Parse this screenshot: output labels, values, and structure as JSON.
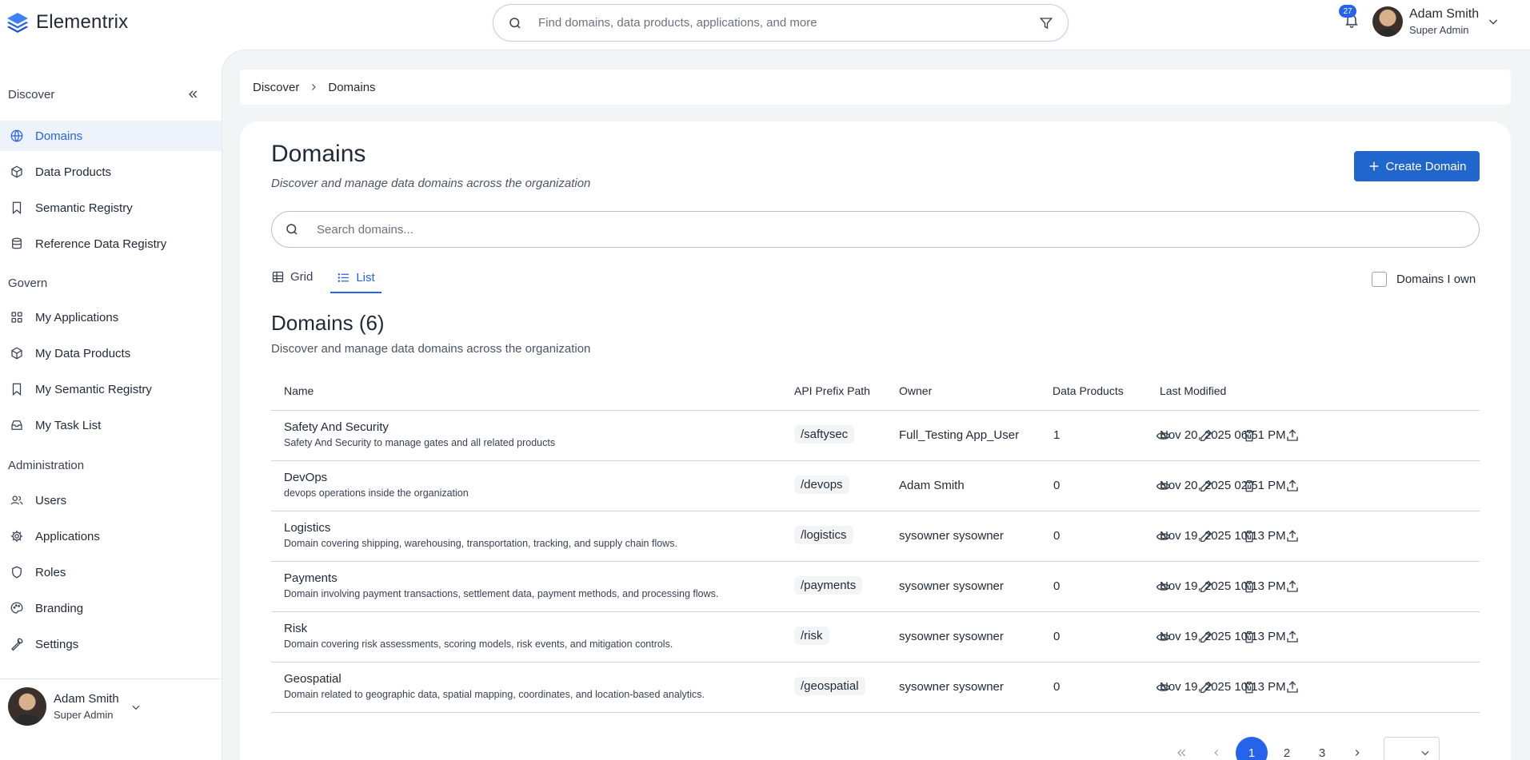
{
  "app": {
    "name": "Elementrix"
  },
  "global_search": {
    "placeholder": "Find domains, data products, applications, and more"
  },
  "notifications": {
    "count": "27"
  },
  "user": {
    "name": "Adam Smith",
    "role": "Super Admin"
  },
  "sidebar": {
    "discover_heading": "Discover",
    "discover_items": [
      {
        "label": "Domains",
        "icon": "globe-icon",
        "active": true
      },
      {
        "label": "Data Products",
        "icon": "cube-icon"
      },
      {
        "label": "Semantic Registry",
        "icon": "bookmark-icon"
      },
      {
        "label": "Reference Data Registry",
        "icon": "database-icon"
      }
    ],
    "govern_heading": "Govern",
    "govern_items": [
      {
        "label": "My Applications",
        "icon": "grid-icon"
      },
      {
        "label": "My Data Products",
        "icon": "cube-icon"
      },
      {
        "label": "My Semantic Registry",
        "icon": "bookmark-icon"
      },
      {
        "label": "My Task List",
        "icon": "inbox-icon"
      }
    ],
    "admin_heading": "Administration",
    "admin_items": [
      {
        "label": "Users",
        "icon": "users-icon"
      },
      {
        "label": "Applications",
        "icon": "gear-icon"
      },
      {
        "label": "Roles",
        "icon": "shield-icon"
      },
      {
        "label": "Branding",
        "icon": "palette-icon"
      },
      {
        "label": "Settings",
        "icon": "wrench-icon"
      }
    ]
  },
  "breadcrumb": [
    "Discover",
    "Domains"
  ],
  "page": {
    "title": "Domains",
    "subtitle": "Discover and manage data domains across the organization",
    "create_button": "Create Domain",
    "search_placeholder": "Search domains...",
    "view_grid": "Grid",
    "view_list": "List",
    "active_view": "List",
    "own_filter_label": "Domains I own",
    "list_title": "Domains (6)",
    "list_subtitle": "Discover and manage data domains across the organization"
  },
  "table": {
    "columns": [
      "Name",
      "API Prefix Path",
      "Owner",
      "Data Products",
      "Last Modified"
    ],
    "rows": [
      {
        "name": "Safety And Security",
        "description": "Safety And Security to manage gates and all related products",
        "prefix": "/saftysec",
        "owner": "Full_Testing App_User",
        "data_products": "1",
        "modified": "Nov 20, 2025 06:51 PM"
      },
      {
        "name": "DevOps",
        "description": "devops operations inside the organization",
        "prefix": "/devops",
        "owner": "Adam Smith",
        "data_products": "0",
        "modified": "Nov 20, 2025 02:51 PM"
      },
      {
        "name": "Logistics",
        "description": "Domain covering shipping, warehousing, transportation, tracking, and supply chain flows.",
        "prefix": "/logistics",
        "owner": "sysowner sysowner",
        "data_products": "0",
        "modified": "Nov 19, 2025 10:13 PM"
      },
      {
        "name": "Payments",
        "description": "Domain involving payment transactions, settlement data, payment methods, and processing flows.",
        "prefix": "/payments",
        "owner": "sysowner sysowner",
        "data_products": "0",
        "modified": "Nov 19, 2025 10:13 PM"
      },
      {
        "name": "Risk",
        "description": "Domain covering risk assessments, scoring models, risk events, and mitigation controls.",
        "prefix": "/risk",
        "owner": "sysowner sysowner",
        "data_products": "0",
        "modified": "Nov 19, 2025 10:13 PM"
      },
      {
        "name": "Geospatial",
        "description": "Domain related to geographic data, spatial mapping, coordinates, and location-based analytics.",
        "prefix": "/geospatial",
        "owner": "sysowner sysowner",
        "data_products": "0",
        "modified": "Nov 19, 2025 10:13 PM"
      }
    ],
    "row_actions": [
      "eye-icon",
      "pencil-icon",
      "trash-icon",
      "upload-icon"
    ]
  },
  "pagination": {
    "pages": [
      "1",
      "2",
      "3"
    ],
    "current": "1"
  },
  "colors": {
    "accent": "#2563eb",
    "button": "#2166cc",
    "active_bg": "#eef3fb"
  }
}
